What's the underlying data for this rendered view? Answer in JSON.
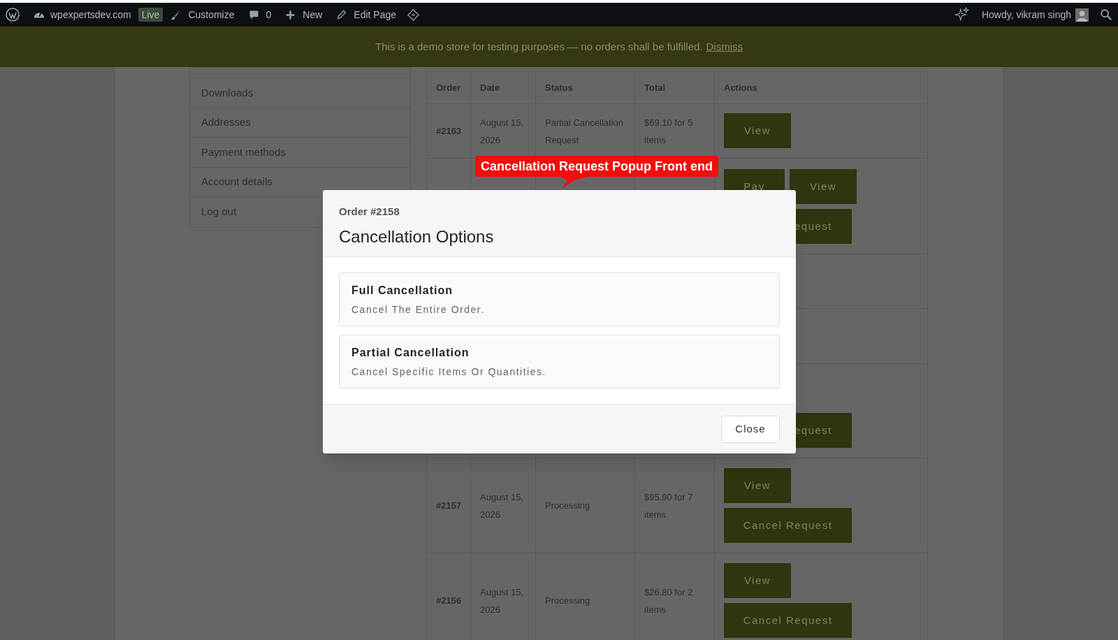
{
  "admin_bar": {
    "site": "wpexpertsdev.com",
    "badge": "Live",
    "items": [
      {
        "kind": "customize",
        "label": "Customize"
      },
      {
        "kind": "comments",
        "label": "0"
      },
      {
        "kind": "new",
        "label": "New"
      },
      {
        "kind": "edit",
        "label": "Edit Page"
      },
      {
        "kind": "diamond"
      }
    ],
    "greeting": "Howdy, vikram singh"
  },
  "notice": {
    "text": "This is a demo store for testing purposes — no orders shall be fulfilled.",
    "link": "Dismiss"
  },
  "account_nav": [
    "Downloads",
    "Addresses",
    "Payment methods",
    "Account details",
    "Log out"
  ],
  "orders": {
    "columns": [
      "Order",
      "Date",
      "Status",
      "Total",
      "Actions"
    ],
    "rows": [
      {
        "order": "#2163",
        "date": "August 15, 2026",
        "status": "Partial Cancellation Request",
        "total": "$69.10 for 5 items",
        "actions": [
          {
            "label": "View",
            "kind": "view"
          }
        ]
      },
      {
        "actions": [
          {
            "label": "Pay",
            "kind": "pay"
          },
          {
            "label": "View",
            "kind": "view"
          },
          {
            "label": "equest",
            "kind": "cut"
          }
        ]
      },
      {},
      {},
      {
        "actions": [
          {
            "label": "equest",
            "kind": "cut"
          }
        ]
      },
      {
        "order": "#2157",
        "date": "August 15, 2026",
        "status": "Processing",
        "total": "$95.90 for 7 items",
        "actions": [
          {
            "label": "View",
            "kind": "view"
          },
          {
            "label": "Cancel Request",
            "kind": "wide"
          }
        ]
      },
      {
        "order": "#2156",
        "date": "August 15, 2026",
        "status": "Processing",
        "total": "$26.80 for 2 items",
        "actions": [
          {
            "label": "View",
            "kind": "view"
          },
          {
            "label": "Cancel Request",
            "kind": "wide"
          }
        ]
      }
    ]
  },
  "callout": "Cancellation Request Popup Front end",
  "modal": {
    "subtitle": "Order #2158",
    "title": "Cancellation Options",
    "options": [
      {
        "title": "Full Cancellation",
        "description": "Cancel The Entire Order."
      },
      {
        "title": "Partial Cancellation",
        "description": "Cancel Specific Items Or Quantities."
      }
    ],
    "close": "Close"
  }
}
